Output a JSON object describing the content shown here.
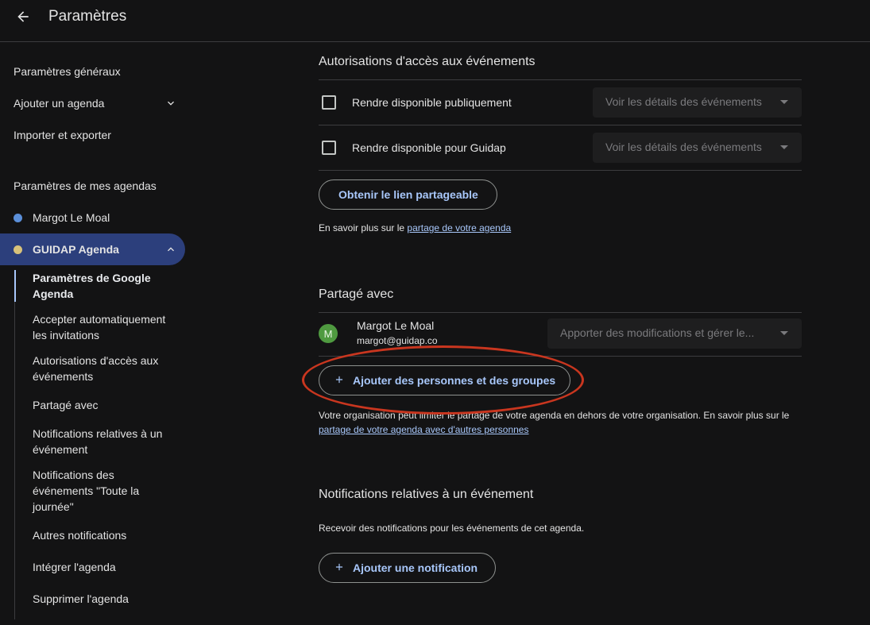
{
  "header": {
    "title": "Paramètres"
  },
  "sidebar": {
    "general_settings": "Paramètres généraux",
    "add_calendar": "Ajouter un agenda",
    "import_export": "Importer et exporter",
    "my_calendars_heading": "Paramètres de mes agendas",
    "calendars": [
      {
        "name": "Margot Le Moal",
        "color": "#5b8fd9"
      },
      {
        "name": "GUIDAP Agenda",
        "color": "#d8c27a"
      }
    ],
    "subnav": [
      "Paramètres de Google Agenda",
      "Accepter automatiquement les invitations",
      "Autorisations d'accès aux événements",
      "Partagé avec",
      "Notifications relatives à un événement",
      "Notifications des événements \"Toute la journée\"",
      "Autres notifications",
      "Intégrer l'agenda",
      "Supprimer l'agenda"
    ]
  },
  "access": {
    "title": "Autorisations d'accès aux événements",
    "public_label": "Rendre disponible publiquement",
    "public_select": "Voir les détails des événements",
    "org_label": "Rendre disponible pour Guidap",
    "org_select": "Voir les détails des événements",
    "share_link_button": "Obtenir le lien partageable",
    "learn_more_prefix": "En savoir plus sur le ",
    "learn_more_link": "partage de votre agenda"
  },
  "shared": {
    "title": "Partagé avec",
    "person": {
      "initial": "M",
      "name": "Margot Le Moal",
      "email": "margot@guidap.co",
      "permission": "Apporter des modifications et gérer le..."
    },
    "add_people_button": "Ajouter des personnes et des groupes",
    "org_note": "Votre organisation peut limiter le partage de votre agenda en dehors de votre organisation. En savoir plus sur le",
    "org_note_link": "partage de votre agenda avec d'autres personnes"
  },
  "notifications": {
    "title": "Notifications relatives à un événement",
    "desc": "Recevoir des notifications pour les événements de cet agenda.",
    "add_button": "Ajouter une notification"
  }
}
